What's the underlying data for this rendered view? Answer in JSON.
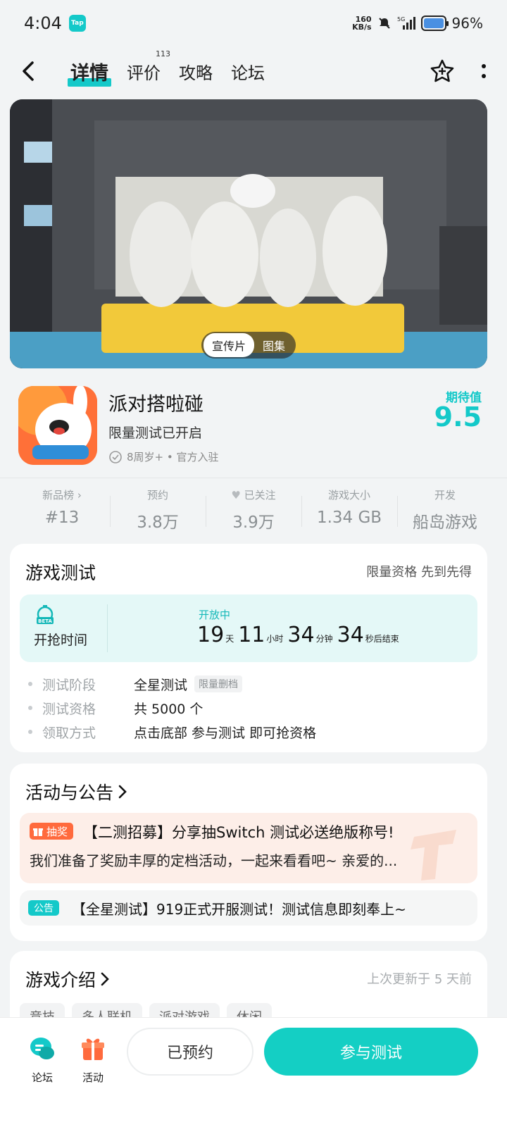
{
  "status_bar": {
    "time": "4:04",
    "app_badge": "Tap",
    "speed_top": "160",
    "speed_bottom": "KB/s",
    "battery": "96%"
  },
  "nav": {
    "tabs": [
      {
        "label": "详情",
        "active": true
      },
      {
        "label": "评价",
        "count": "113"
      },
      {
        "label": "攻略"
      },
      {
        "label": "论坛"
      }
    ]
  },
  "hero": {
    "video_tab": "宣传片",
    "gallery_tab": "图集"
  },
  "game": {
    "name": "派对搭啦碰",
    "subtitle": "限量测试已开启",
    "meta": "8周岁+ • 官方入驻",
    "expect_label": "期待值",
    "expect_value": "9.5"
  },
  "stats": [
    {
      "label": "新品榜 ›",
      "value": "#13"
    },
    {
      "label": "预约",
      "value": "3.8万"
    },
    {
      "label": "已关注",
      "value": "3.9万"
    },
    {
      "label": "游戏大小",
      "value": "1.34 GB"
    },
    {
      "label": "开发",
      "value": "船岛游戏"
    }
  ],
  "test_card": {
    "title": "游戏测试",
    "right": "限量资格 先到先得",
    "beta": "BETA",
    "grab_time": "开抢时间",
    "status": "开放中",
    "countdown": {
      "days": "19",
      "days_u": "天",
      "hours": "11",
      "hours_u": "小时",
      "mins": "34",
      "mins_u": "分钟",
      "secs": "34",
      "secs_u": "秒后结束"
    },
    "rows": [
      {
        "k": "测试阶段",
        "v": "全星测试",
        "tag": "限量删档"
      },
      {
        "k": "测试资格",
        "v": "共 5000 个"
      },
      {
        "k": "领取方式",
        "v": "点击底部 参与测试 即可抢资格"
      }
    ]
  },
  "activity_card": {
    "title": "活动与公告",
    "item1": {
      "badge": "抽奖",
      "title": "【二测招募】分享抽Switch 测试必送绝版称号!",
      "desc": "我们准备了奖励丰厚的定档活动，一起来看看吧~ 亲爱的..."
    },
    "item2": {
      "badge": "公告",
      "title": "【全星测试】919正式开服测试！测试信息即刻奉上~"
    }
  },
  "intro_card": {
    "title": "游戏介绍",
    "updated": "上次更新于 5 天前",
    "tags": [
      "竞技",
      "多人联机",
      "派对游戏",
      "休闲"
    ]
  },
  "bottom": {
    "forum": "论坛",
    "activity": "活动",
    "reserved": "已预约",
    "join": "参与测试"
  }
}
